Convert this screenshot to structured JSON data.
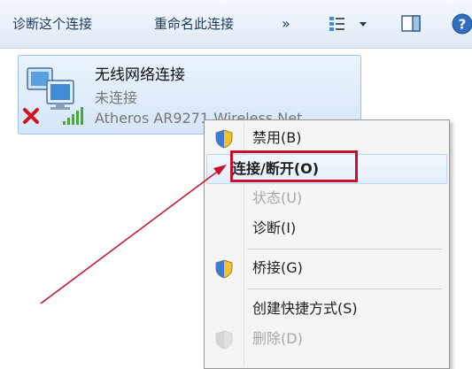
{
  "toolbar": {
    "diagnose_label": "诊断这个连接",
    "rename_label": "重命名此连接",
    "more_label": "»"
  },
  "connection": {
    "name": "无线网络连接",
    "status": "未连接",
    "device": "Atheros AR9271 Wireless Net"
  },
  "context_menu": {
    "items": [
      {
        "label": "禁用(B)",
        "icon": "shield-icon",
        "state": "normal"
      },
      {
        "label": "连接/断开(O)",
        "icon": "",
        "state": "default-highlighted"
      },
      {
        "label": "状态(U)",
        "icon": "",
        "state": "disabled"
      },
      {
        "label": "诊断(I)",
        "icon": "",
        "state": "normal"
      },
      {
        "label": "桥接(G)",
        "icon": "shield-icon",
        "state": "normal"
      },
      {
        "label": "创建快捷方式(S)",
        "icon": "",
        "state": "normal"
      },
      {
        "label": "删除(D)",
        "icon": "shield-icon",
        "state": "disabled"
      }
    ]
  },
  "annotation": {
    "color": "#c8102e"
  }
}
